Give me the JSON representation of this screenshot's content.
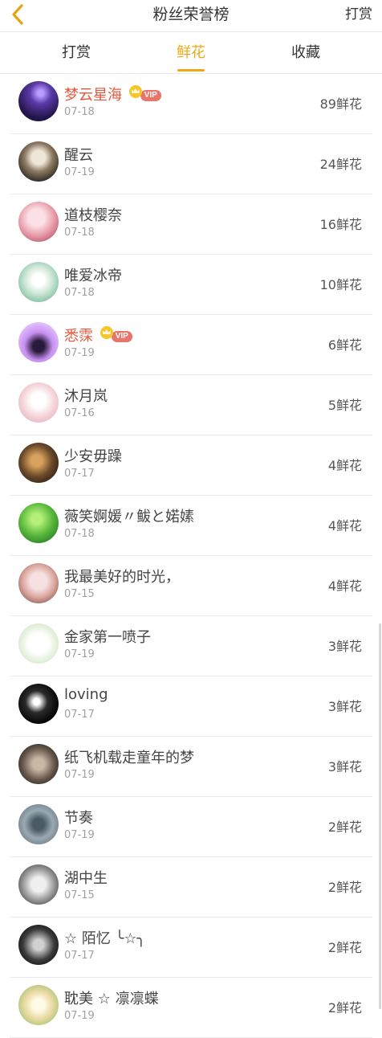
{
  "header": {
    "title": "粉丝荣誉榜",
    "action": "打赏"
  },
  "tabs": [
    {
      "label": "打赏",
      "active": false
    },
    {
      "label": "鲜花",
      "active": true
    },
    {
      "label": "收藏",
      "active": false
    }
  ],
  "vip_label": "VIP",
  "accent_color": "#f0a817",
  "rows": [
    {
      "name": "梦云星海",
      "vip": true,
      "date": "07-18",
      "count": "89鲜花"
    },
    {
      "name": "醒云",
      "vip": false,
      "date": "07-19",
      "count": "24鲜花"
    },
    {
      "name": "道枝樱奈",
      "vip": false,
      "date": "07-18",
      "count": "16鲜花"
    },
    {
      "name": "唯爱冰帝",
      "vip": false,
      "date": "07-18",
      "count": "10鲜花"
    },
    {
      "name": "悉霂",
      "vip": true,
      "date": "07-19",
      "count": "6鲜花"
    },
    {
      "name": "沐月岚",
      "vip": false,
      "date": "07-16",
      "count": "5鲜花"
    },
    {
      "name": "少安毋躁",
      "vip": false,
      "date": "07-17",
      "count": "4鲜花"
    },
    {
      "name": "薇笑婀媛〃鲅と婼嫊",
      "vip": false,
      "date": "07-18",
      "count": "4鲜花"
    },
    {
      "name": "我最美好的时光，",
      "vip": false,
      "date": "07-15",
      "count": "4鲜花"
    },
    {
      "name": "金家第一喷子",
      "vip": false,
      "date": "07-19",
      "count": "3鲜花"
    },
    {
      "name": "loving",
      "vip": false,
      "date": "07-17",
      "count": "3鲜花"
    },
    {
      "name": "纸飞机载走童年的梦",
      "vip": false,
      "date": "07-19",
      "count": "3鲜花"
    },
    {
      "name": "节奏",
      "vip": false,
      "date": "07-19",
      "count": "2鲜花"
    },
    {
      "name": "湖中生",
      "vip": false,
      "date": "07-15",
      "count": "2鲜花"
    },
    {
      "name": "☆ 陌忆 ╰☆╮",
      "vip": false,
      "date": "07-17",
      "count": "2鲜花"
    },
    {
      "name": "耽美 ☆ 凛凛蝶",
      "vip": false,
      "date": "07-19",
      "count": "2鲜花"
    }
  ]
}
